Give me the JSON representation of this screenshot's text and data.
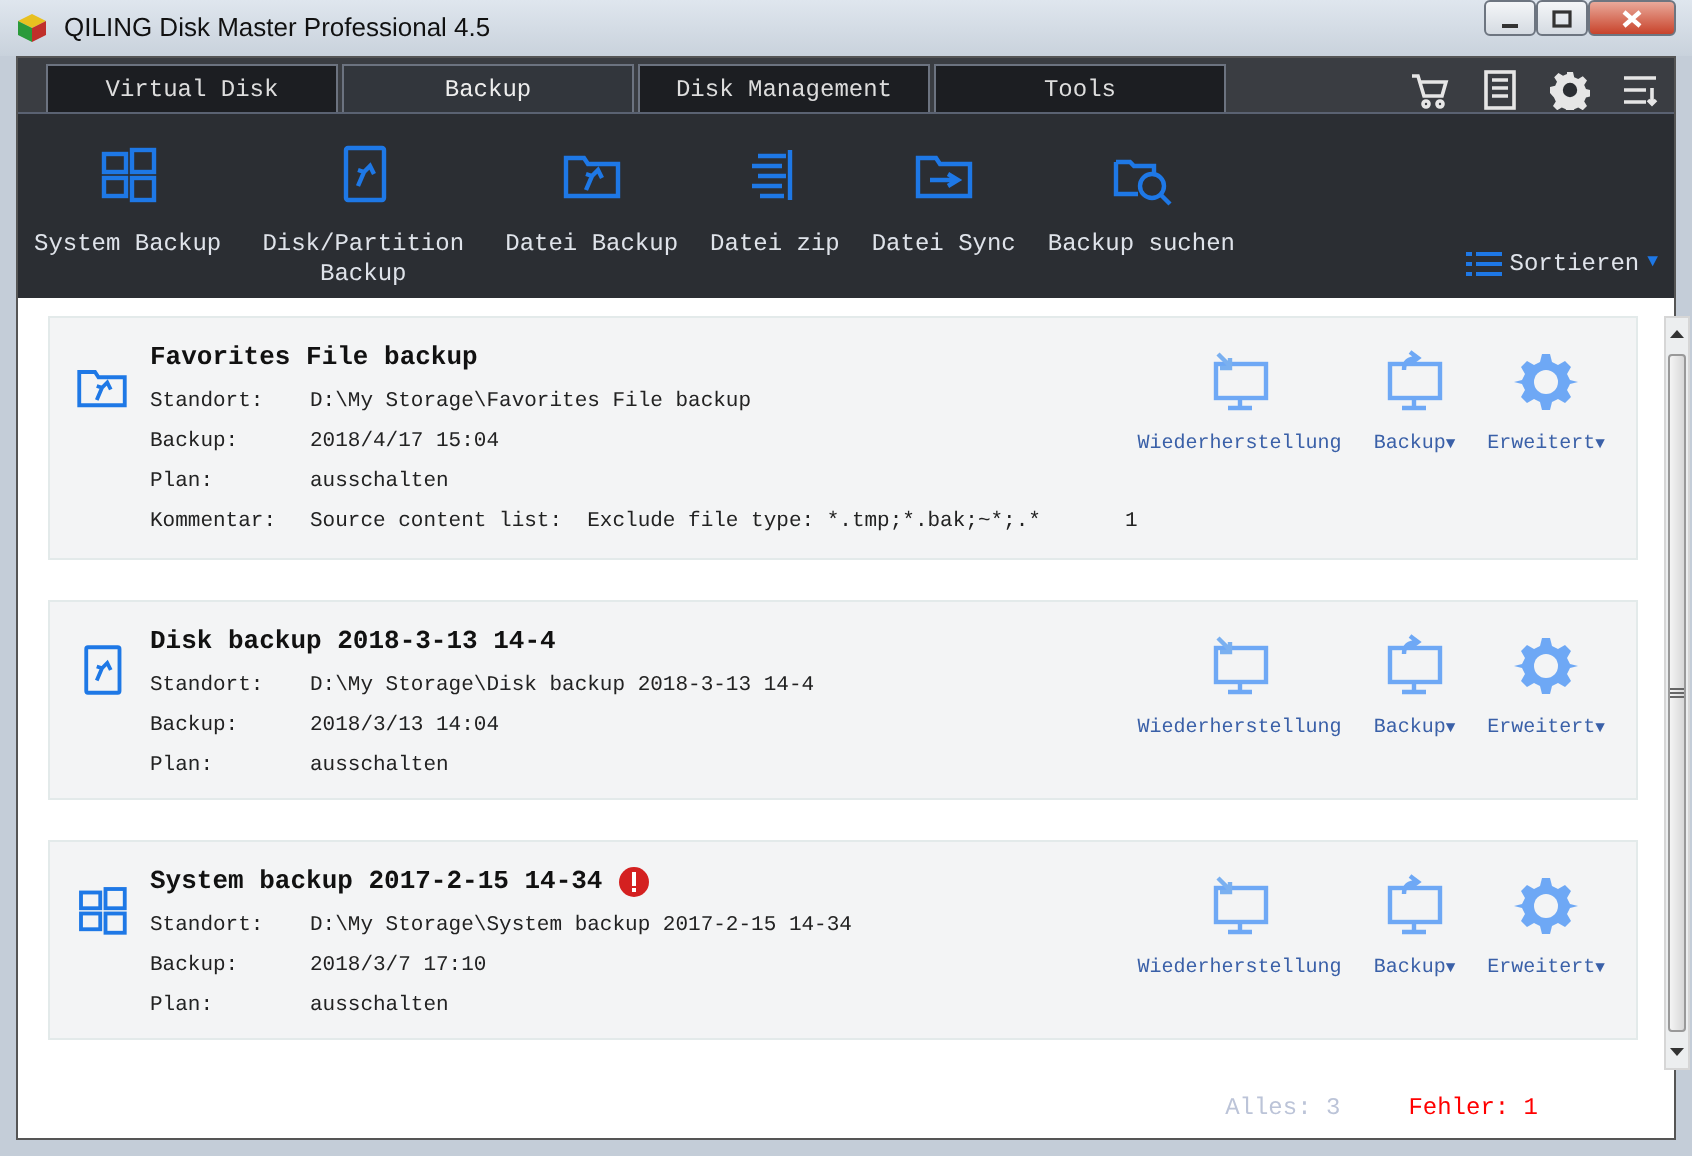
{
  "window": {
    "title": "QILING Disk Master Professional 4.5"
  },
  "tabs": [
    {
      "label": "Virtual Disk",
      "selected": false
    },
    {
      "label": "Backup",
      "selected": true
    },
    {
      "label": "Disk Management",
      "selected": false
    },
    {
      "label": "Tools",
      "selected": false
    }
  ],
  "header_icons": [
    {
      "kind": "cart"
    },
    {
      "kind": "list"
    },
    {
      "kind": "gear"
    },
    {
      "kind": "menu"
    }
  ],
  "toolbar": [
    {
      "label": "System Backup",
      "kind": "windows"
    },
    {
      "label": "Disk/Partition Backup",
      "kind": "disk"
    },
    {
      "label": "Datei Backup",
      "kind": "folder"
    },
    {
      "label": "Datei zip",
      "kind": "zip"
    },
    {
      "label": "Datei Sync",
      "kind": "sync"
    },
    {
      "label": "Backup suchen",
      "kind": "search"
    }
  ],
  "sort": {
    "label": "Sortieren",
    "caret": "▼"
  },
  "backups": [
    {
      "title": "Favorites File backup",
      "kind": "folder",
      "error": false,
      "fields": [
        {
          "label": "Standort:",
          "value": "D:\\My Storage\\Favorites File backup"
        },
        {
          "label": "Backup:",
          "value": "2018/4/17 15:04"
        },
        {
          "label": "Plan:",
          "value": "ausschalten"
        },
        {
          "label": "Kommentar:",
          "value": "Source content list:  Exclude file type: *.tmp;*.bak;~*;.*",
          "extra": "1"
        }
      ],
      "actions": [
        {
          "label": "Wiederherstellung",
          "kind": "restore"
        },
        {
          "label": "Backup",
          "kind": "backup",
          "caret": "▼"
        },
        {
          "label": "Erweitert",
          "kind": "gear",
          "caret": "▼"
        }
      ]
    },
    {
      "title": "Disk backup 2018-3-13 14-4",
      "kind": "disk",
      "error": false,
      "fields": [
        {
          "label": "Standort:",
          "value": "D:\\My Storage\\Disk backup 2018-3-13 14-4"
        },
        {
          "label": "Backup:",
          "value": "2018/3/13 14:04"
        },
        {
          "label": "Plan:",
          "value": "ausschalten"
        }
      ],
      "actions": [
        {
          "label": "Wiederherstellung",
          "kind": "restore"
        },
        {
          "label": "Backup",
          "kind": "backup",
          "caret": "▼"
        },
        {
          "label": "Erweitert",
          "kind": "gear",
          "caret": "▼"
        }
      ]
    },
    {
      "title": "System backup 2017-2-15 14-34",
      "kind": "windows",
      "error": true,
      "fields": [
        {
          "label": "Standort:",
          "value": "D:\\My Storage\\System backup 2017-2-15 14-34"
        },
        {
          "label": "Backup:",
          "value": "2018/3/7 17:10"
        },
        {
          "label": "Plan:",
          "value": "ausschalten"
        }
      ],
      "actions": [
        {
          "label": "Wiederherstellung",
          "kind": "restore"
        },
        {
          "label": "Backup",
          "kind": "backup",
          "caret": "▼"
        },
        {
          "label": "Erweitert",
          "kind": "gear",
          "caret": "▼"
        }
      ]
    }
  ],
  "status": {
    "total": "Alles: 3",
    "errors": "Fehler: 1"
  }
}
